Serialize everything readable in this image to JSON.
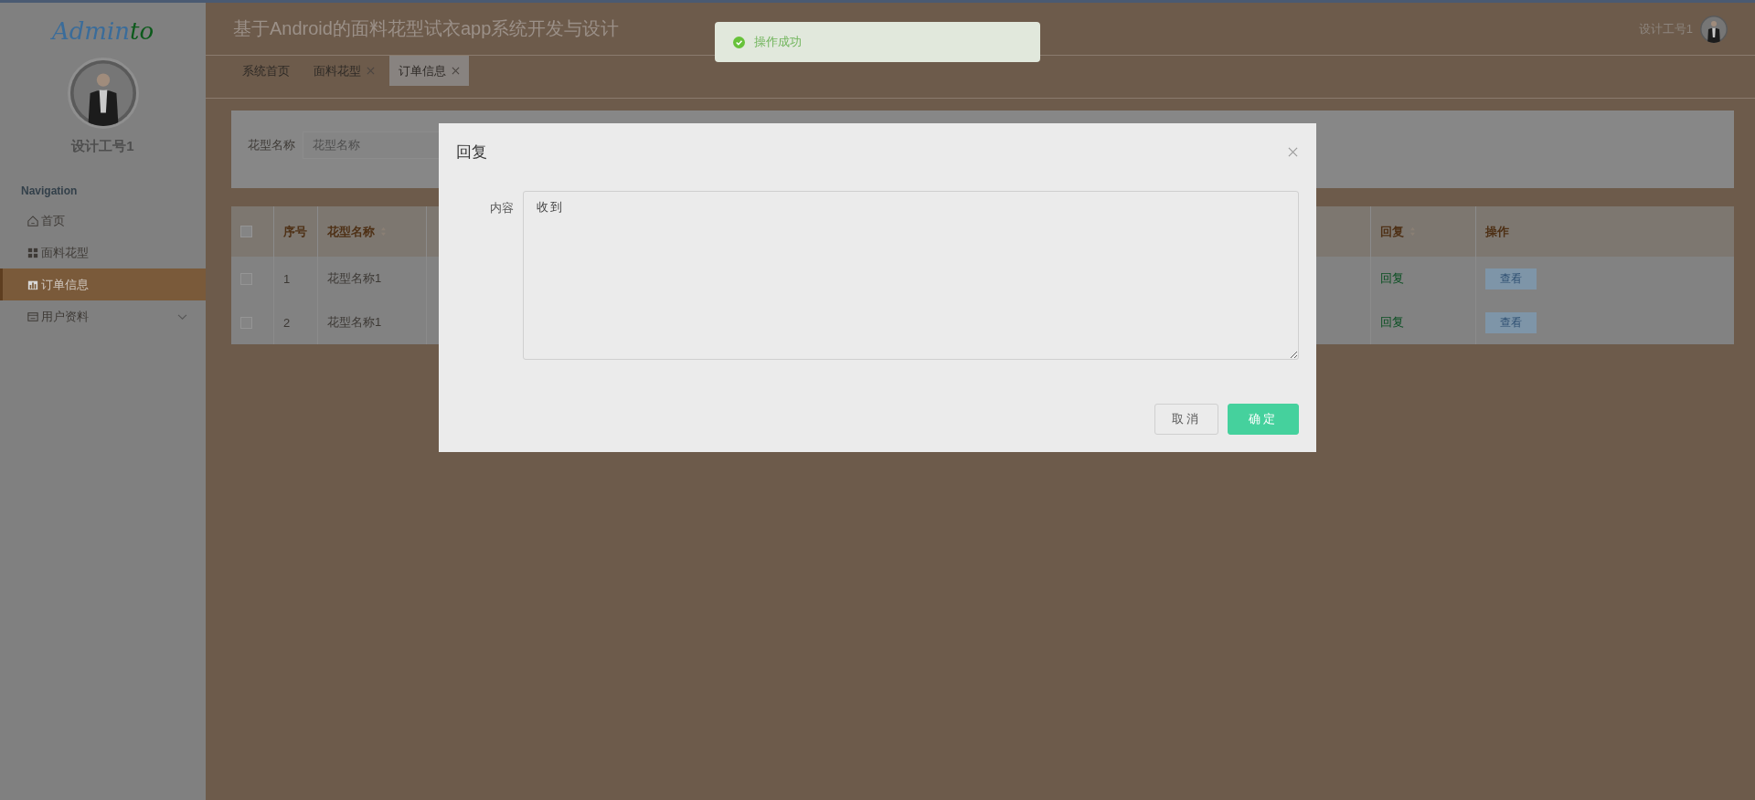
{
  "sidebar": {
    "logo": {
      "main": "Admin",
      "accent": "to"
    },
    "username": "设计工号1",
    "section_label": "Navigation",
    "items": [
      {
        "label": "首页",
        "kind": "home",
        "selected": false
      },
      {
        "label": "面料花型",
        "kind": "pattern",
        "selected": false
      },
      {
        "label": "订单信息",
        "kind": "order",
        "selected": true
      },
      {
        "label": "用户资料",
        "kind": "profile",
        "selected": false,
        "expanded": false
      }
    ]
  },
  "header": {
    "title": "基于Android的面料花型试衣app系统开发与设计",
    "user": "设计工号1"
  },
  "tabs": [
    {
      "label": "系统首页",
      "closable": false,
      "selected": false
    },
    {
      "label": "面料花型",
      "closable": true,
      "selected": false
    },
    {
      "label": "订单信息",
      "closable": true,
      "selected": true
    }
  ],
  "search": {
    "label": "花型名称",
    "placeholder": "花型名称"
  },
  "table": {
    "columns": [
      {
        "kind": "check",
        "checked": false
      },
      {
        "label": "序号",
        "sortable": false
      },
      {
        "label": "花型名称",
        "sortable": true
      },
      {
        "kind": "hidden"
      },
      {
        "label": "回复",
        "sortable": true
      },
      {
        "label": "操作",
        "sortable": false
      }
    ],
    "rows": [
      {
        "checked": false,
        "index": "1",
        "name": "花型名称1",
        "reply_link": "回复",
        "action": "查看"
      },
      {
        "checked": false,
        "index": "2",
        "name": "花型名称1",
        "reply_link": "回复",
        "action": "查看"
      }
    ]
  },
  "toast": {
    "message": "操作成功"
  },
  "dialog": {
    "title": "回复",
    "field_label": "内容",
    "value": "收到",
    "buttons": [
      {
        "label": "取消",
        "kind": "default"
      },
      {
        "label": "确定",
        "kind": "primary"
      }
    ]
  }
}
